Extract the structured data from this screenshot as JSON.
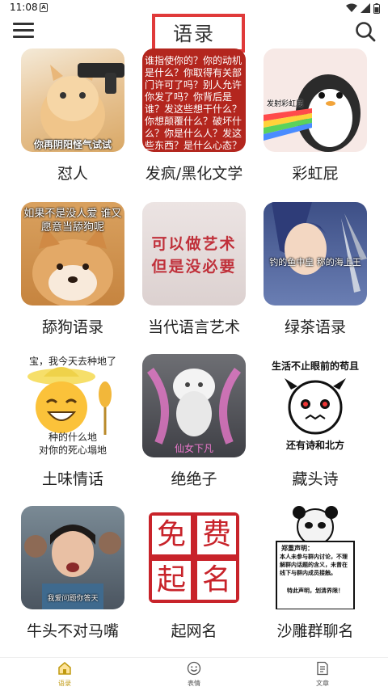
{
  "status_bar": {
    "time": "11:08",
    "notification_letter": "A"
  },
  "header": {
    "title": "语录",
    "accent_color": "#e03a3a"
  },
  "grid": [
    {
      "label": "怼人",
      "overlay": "你再阴阳怪气试试"
    },
    {
      "label": "发疯/黑化文学",
      "overlay": "谁指使你的？你的动机是什么？你取得有关部门许可了吗？别人允许你发了吗？你背后是谁？发这些想干什么？你想颠覆什么？破坏什么？你是什么人？发这些东西？是什么心态？你用"
    },
    {
      "label": "彩虹屁",
      "overlay": "发射彩虹屁"
    },
    {
      "label": "舔狗语录",
      "overlay": "如果不是没人爱 谁又愿意当舔狗呢"
    },
    {
      "label": "当代语言艺术",
      "overlay": "可以做艺术 但是没必要"
    },
    {
      "label": "绿茶语录",
      "overlay": "钓的鱼中皇 称的海上王"
    },
    {
      "label": "土味情话",
      "overlay_top": "宝，我今天去种地了",
      "overlay_mid": "种的什么地",
      "overlay_bottom": "对你的死心塌地"
    },
    {
      "label": "绝绝子",
      "overlay": "仙女下凡"
    },
    {
      "label": "藏头诗",
      "overlay_top": "生活不止眼前的苟且",
      "overlay_bottom": "还有诗和北方"
    },
    {
      "label": "牛头不对马嘴",
      "overlay": "我爱问题你答天"
    },
    {
      "label": "起网名",
      "seal_chars": [
        "免",
        "费",
        "起",
        "名"
      ]
    },
    {
      "label": "沙雕群聊名",
      "notice_title": "郑重声明：",
      "notice_body": "本人未参与群内讨论，不理解群内话题的含义，未曾在线下与群内成员接触。",
      "notice_end": "特此声明，划清界限！"
    }
  ],
  "bottom_nav": [
    {
      "label": "语录",
      "icon": "home-icon",
      "active": true
    },
    {
      "label": "表情",
      "icon": "smile-icon",
      "active": false
    },
    {
      "label": "文章",
      "icon": "document-icon",
      "active": false
    }
  ]
}
